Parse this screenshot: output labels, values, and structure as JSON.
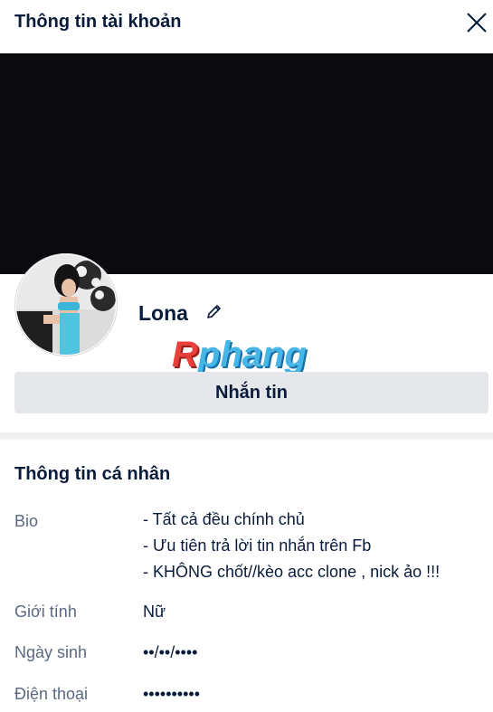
{
  "header": {
    "title": "Thông tin tài khoản",
    "close_icon": "close-icon"
  },
  "profile": {
    "name": "Lona",
    "edit_icon": "pencil-icon",
    "cover_color": "#0b0a0f"
  },
  "watermark": {
    "first": "R",
    "rest": "phang"
  },
  "actions": {
    "message_label": "Nhắn tin"
  },
  "personal": {
    "section_title": "Thông tin cá nhân",
    "bio_label": "Bio",
    "bio_lines": [
      "- Tất cả đều chính chủ",
      "- Ưu tiên trả lời tin nhắn trên Fb",
      "- KHÔNG chốt//kèo acc clone , nick ảo !!!"
    ],
    "gender_label": "Giới tính",
    "gender_value": "Nữ",
    "birthday_label": "Ngày sinh",
    "birthday_value": "••/••/••••",
    "phone_label": "Điện thoại",
    "phone_value": "••••••••••"
  }
}
